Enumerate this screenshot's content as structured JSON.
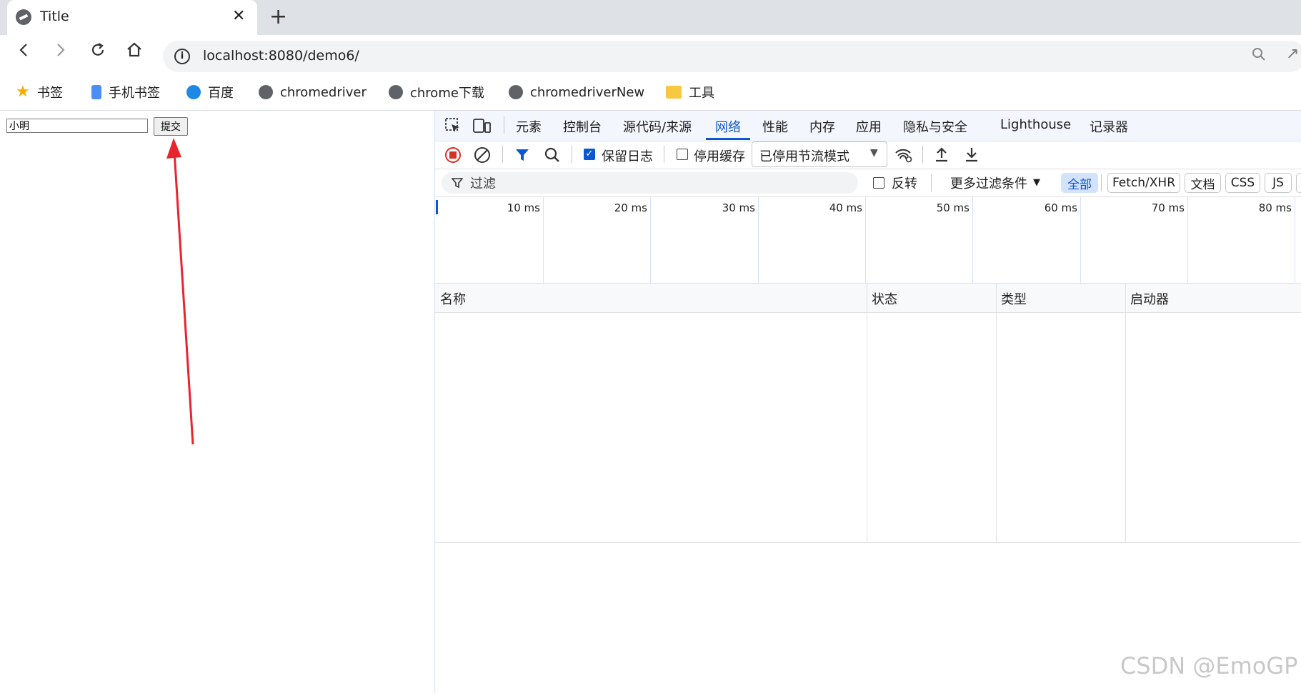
{
  "browser": {
    "tab_title": "Title",
    "new_tab_symbol": "+",
    "close_symbol": "✕",
    "url": "localhost:8080/demo6/"
  },
  "bookmarks": [
    {
      "label": "书签",
      "icon": "star-icon"
    },
    {
      "label": "手机书签",
      "icon": "phone-icon"
    },
    {
      "label": "百度",
      "icon": "edge-icon"
    },
    {
      "label": "chromedriver",
      "icon": "chrome-icon"
    },
    {
      "label": "chrome下载",
      "icon": "chrome-icon"
    },
    {
      "label": "chromedriverNew",
      "icon": "chrome-icon"
    },
    {
      "label": "工具",
      "icon": "folder-icon"
    }
  ],
  "page": {
    "input_value": "小明",
    "submit_label": "提交",
    "arrow_color": "#e8242c"
  },
  "devtools": {
    "tabs": [
      "元素",
      "控制台",
      "源代码/来源",
      "网络",
      "性能",
      "内存",
      "应用",
      "隐私与安全",
      "Lighthouse",
      "记录器"
    ],
    "active_tab": "网络",
    "preserve_log": "保留日志",
    "disable_cache": "停用缓存",
    "throttle": "已停用节流模式",
    "filter_placeholder": "过滤",
    "invert": "反转",
    "more_filters": "更多过滤条件",
    "type_filters": [
      "全部",
      "Fetch/XHR",
      "文档",
      "CSS",
      "JS"
    ],
    "timeline_ticks": [
      "10 ms",
      "20 ms",
      "30 ms",
      "40 ms",
      "50 ms",
      "60 ms",
      "70 ms",
      "80 ms"
    ],
    "columns": [
      "名称",
      "状态",
      "类型",
      "启动器"
    ],
    "accent": "#0b57d0"
  },
  "watermark": "CSDN @EmoGP"
}
